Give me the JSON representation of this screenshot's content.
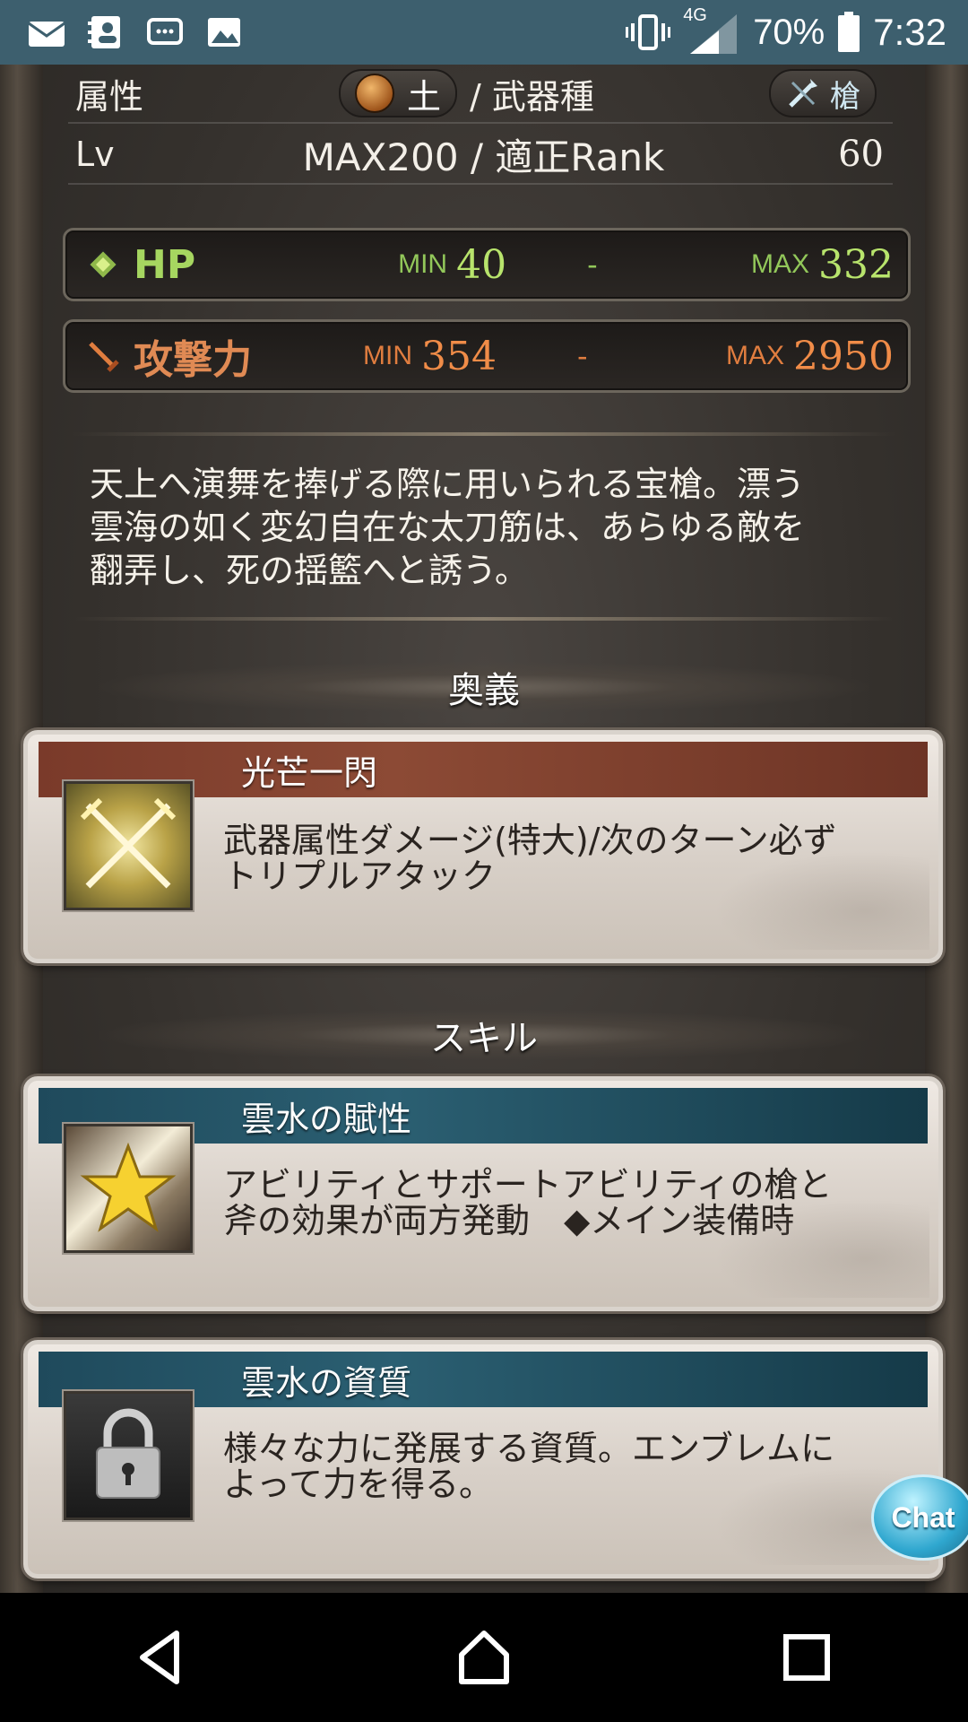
{
  "status_bar": {
    "network": "4G",
    "battery": "70%",
    "time": "7:32",
    "left_icons": [
      "mail-icon",
      "contacts-icon",
      "chat-app-icon",
      "gallery-icon"
    ],
    "right_icons": [
      "vibrate-icon",
      "signal-icon",
      "battery-icon"
    ]
  },
  "weapon_info": {
    "attribute_label": "属性",
    "element_value": "土",
    "weapon_type_label": "/ 武器種",
    "weapon_type_value": "槍",
    "level_label": "Lv",
    "level_max": "MAX200 / 適正Rank",
    "rank_value": "60"
  },
  "stats": {
    "hp": {
      "label": "HP",
      "min_label": "MIN",
      "min": "40",
      "dash": "-",
      "max_label": "MAX",
      "max": "332",
      "color": "#a6d660"
    },
    "attack": {
      "label": "攻撃力",
      "min_label": "MIN",
      "min": "354",
      "dash": "-",
      "max_label": "MAX",
      "max": "2950",
      "color": "#e08a54"
    }
  },
  "description": {
    "line1": "天上へ演舞を捧げる際に用いられる宝槍。漂う",
    "line2": "雲海の如く変幻自在な太刀筋は、あらゆる敵を",
    "line3": "翻弄し、死の揺籃へと誘う。"
  },
  "ougi": {
    "section_title": "奥義",
    "card": {
      "title": "光芒一閃",
      "line1": "武器属性ダメージ(特大)/次のターン必ず",
      "line2": "トリプルアタック",
      "icon": "crossed-swords-icon"
    }
  },
  "skills": {
    "section_title": "スキル",
    "items": [
      {
        "title": "雲水の賦性",
        "line1": "アビリティとサポートアビリティの槍と",
        "line2": "斧の効果が両方発動　◆メイン装備時",
        "icon": "star-icon"
      },
      {
        "title": "雲水の資質",
        "line1": "様々な力に発展する資質。エンブレムに",
        "line2": "よって力を得る。",
        "icon": "lock-icon"
      }
    ]
  },
  "chat_button": {
    "label": "Chat"
  },
  "nav": {
    "icons": [
      "back-icon",
      "home-icon",
      "recents-icon"
    ]
  }
}
